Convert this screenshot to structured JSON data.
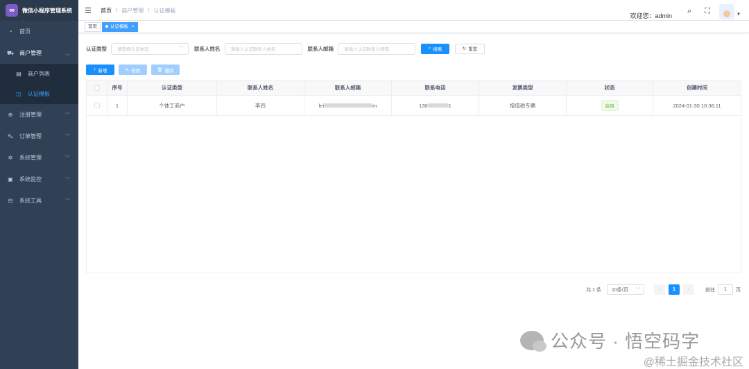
{
  "sidebar": {
    "app_name": "微信小程序管理系统",
    "menu": [
      {
        "label": "首页",
        "icon": "dashboard-icon"
      },
      {
        "label": "商户管理",
        "icon": "merchant-icon",
        "open": true,
        "children": [
          {
            "label": "商户列表",
            "icon": "list-icon"
          },
          {
            "label": "认证模板",
            "icon": "template-icon",
            "active": true
          }
        ]
      },
      {
        "label": "注册管理",
        "icon": "register-icon"
      },
      {
        "label": "订单管理",
        "icon": "cart-icon"
      },
      {
        "label": "系统管理",
        "icon": "gear-icon"
      },
      {
        "label": "系统监控",
        "icon": "monitor-icon"
      },
      {
        "label": "系统工具",
        "icon": "toolbox-icon"
      }
    ]
  },
  "topbar": {
    "breadcrumb": [
      "首页",
      "商户管理",
      "认证模板"
    ],
    "greeting": "欢迎您：admin"
  },
  "tags": [
    {
      "label": "首页"
    },
    {
      "label": "认证模板",
      "active": true,
      "close": "×"
    }
  ],
  "search": {
    "cert_type_label": "认证类型",
    "cert_type_placeholder": "请选择认证类型",
    "contact_name_label": "联系人姓名",
    "contact_name_placeholder": "请输入认证联系人姓名",
    "contact_email_label": "联系人邮箱",
    "contact_email_placeholder": "请输入认证联系人邮箱",
    "search_btn": "搜索",
    "reset_btn": "重置"
  },
  "toolbar": {
    "add": "新增",
    "edit": "修改",
    "delete": "删除"
  },
  "table": {
    "columns": [
      "序号",
      "认证类型",
      "联系人姓名",
      "联系人邮箱",
      "联系电话",
      "发票类型",
      "状态",
      "创建时间"
    ],
    "rows": [
      {
        "index": "1",
        "cert_type": "个体工商户",
        "contact_name": "李四",
        "email_prefix": "lei",
        "email_suffix": "m",
        "phone_prefix": "130",
        "phone_suffix": "1",
        "invoice_type": "增值税专票",
        "status": "启用",
        "created": "2024-01-30 10:36:11"
      }
    ]
  },
  "pagination": {
    "total": "共 1 条",
    "page_size": "10条/页",
    "current_page": "1",
    "goto_label": "前往",
    "goto_value": "1",
    "page_unit": "页"
  },
  "watermark": {
    "line1": "公众号 · 悟空码字",
    "line2": "@稀土掘金技术社区"
  }
}
